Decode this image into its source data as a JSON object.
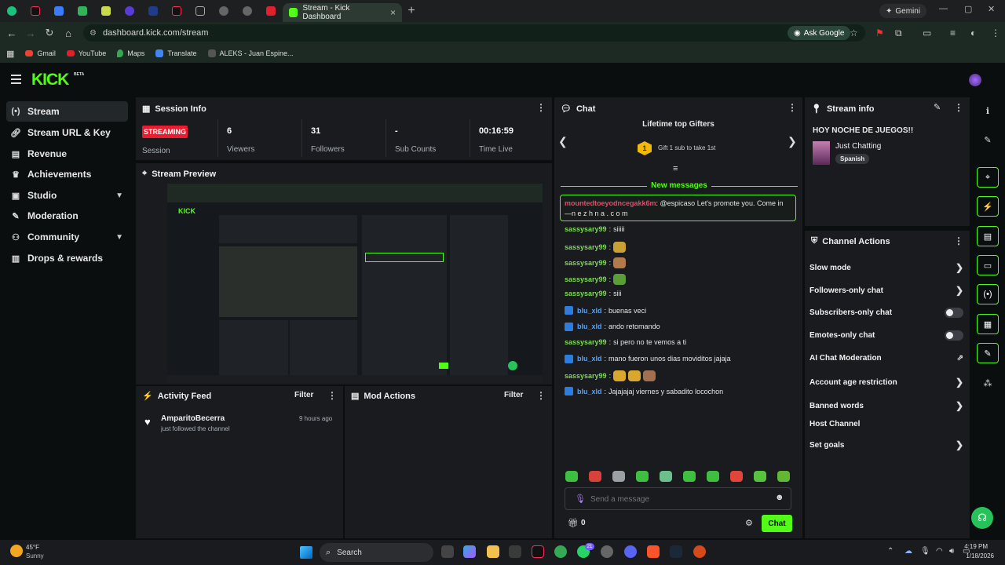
{
  "browser": {
    "active_tab_title": "Stream - Kick Dashboard",
    "gemini_label": "Gemini",
    "url": "dashboard.kick.com/stream",
    "ask_google": "Ask Google",
    "bookmarks": [
      "Gmail",
      "YouTube",
      "Maps",
      "Translate",
      "ALEKS - Juan Espine..."
    ]
  },
  "header": {
    "logo": "KICK",
    "beta": "BETA"
  },
  "sidebar": {
    "items": [
      {
        "label": "Stream",
        "icon": "stream-icon"
      },
      {
        "label": "Stream URL & Key",
        "icon": "link-icon"
      },
      {
        "label": "Revenue",
        "icon": "revenue-icon"
      },
      {
        "label": "Achievements",
        "icon": "trophy-icon"
      },
      {
        "label": "Studio",
        "icon": "studio-icon"
      },
      {
        "label": "Moderation",
        "icon": "wrench-icon"
      },
      {
        "label": "Community",
        "icon": "community-icon"
      },
      {
        "label": "Drops & rewards",
        "icon": "drops-icon"
      }
    ]
  },
  "session": {
    "title": "Session Info",
    "badge": "STREAMING",
    "session_label": "Session",
    "stats": [
      {
        "value": "6",
        "label": "Viewers"
      },
      {
        "value": "31",
        "label": "Followers"
      },
      {
        "value": "-",
        "label": "Sub Counts"
      },
      {
        "value": "00:16:59",
        "label": "Time Live"
      }
    ]
  },
  "preview": {
    "title": "Stream Preview"
  },
  "activity": {
    "title": "Activity Feed",
    "filter": "Filter",
    "user": "AmparitoBecerra",
    "action": "just followed the channel",
    "time": "9 hours ago"
  },
  "mod": {
    "title": "Mod Actions",
    "filter": "Filter"
  },
  "chat": {
    "title": "Chat",
    "gifters_title": "Lifetime top Gifters",
    "gift_text": "Gift 1 sub to take 1st",
    "gift_rank": "1",
    "new_messages": "New messages",
    "highlight_user": "mountedtoeyodncegakk6m",
    "highlight_text": ": @espicaso Let's promote you. Come in",
    "highlight_link": "—n e z h n a . c o m",
    "messages": [
      {
        "user": "sassysary99",
        "text": " siiiii",
        "color": "#7ed957",
        "emotes": 0
      },
      {
        "user": "sassysary99",
        "text": "",
        "color": "#7ed957",
        "emotes": 1
      },
      {
        "user": "sassysary99",
        "text": "",
        "color": "#7ed957",
        "emotes": 1
      },
      {
        "user": "sassysary99",
        "text": "",
        "color": "#7ed957",
        "emotes": 1
      },
      {
        "user": "sassysary99",
        "text": " siii",
        "color": "#7ed957",
        "emotes": 0
      },
      {
        "user": "blu_xld",
        "text": " buenas veci",
        "color": "#4fa3ff",
        "emotes": 0
      },
      {
        "user": "blu_xld",
        "text": " ando retomando",
        "color": "#4fa3ff",
        "emotes": 0
      },
      {
        "user": "sassysary99",
        "text": " si pero no te vemos a ti",
        "color": "#7ed957",
        "emotes": 0
      },
      {
        "user": "blu_xld",
        "text": " mano fueron unos dias moviditos jajaja",
        "color": "#4fa3ff",
        "emotes": 0
      },
      {
        "user": "sassysary99",
        "text": "",
        "color": "#7ed957",
        "emotes": 3
      },
      {
        "user": "blu_xld",
        "text": " Jajajajaj viernes y sabadito locochon",
        "color": "#4fa3ff",
        "emotes": 0
      }
    ],
    "placeholder": "Send a message",
    "count": "0",
    "send": "Chat"
  },
  "stream_info": {
    "title": "Stream info",
    "stream_title": "HOY NOCHE DE JUEGOS!!",
    "category": "Just Chatting",
    "language": "Spanish"
  },
  "channel_actions": {
    "title": "Channel Actions",
    "items": [
      {
        "label": "Slow mode",
        "kind": "arrow"
      },
      {
        "label": "Followers-only chat",
        "kind": "arrow"
      },
      {
        "label": "Subscribers-only chat",
        "kind": "toggle"
      },
      {
        "label": "Emotes-only chat",
        "kind": "toggle"
      },
      {
        "label": "AI Chat Moderation",
        "kind": "external"
      },
      {
        "label": "Account age restriction",
        "kind": "arrow"
      },
      {
        "label": "Banned words",
        "kind": "arrow"
      },
      {
        "label": "Host Channel",
        "kind": "none"
      },
      {
        "label": "Set goals",
        "kind": "arrow"
      }
    ]
  },
  "taskbar": {
    "temp": "45°F",
    "weather": "Sunny",
    "search": "Search",
    "time": "4:19 PM",
    "date": "1/18/2026",
    "badge_count": "21"
  },
  "colors": {
    "accent": "#53fc18",
    "panel": "#191b1f",
    "bg": "#0b0e0f",
    "live": "#eb1c2f"
  }
}
